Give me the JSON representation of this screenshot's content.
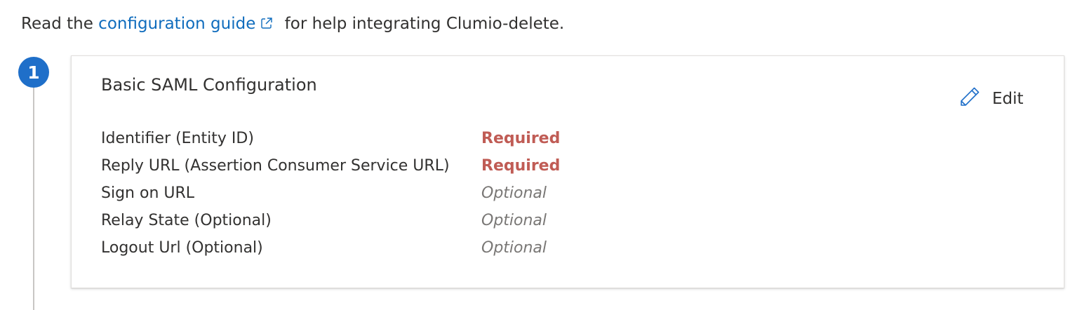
{
  "intro": {
    "prefix": "Read the ",
    "link_text": "configuration guide",
    "suffix": " for help integrating Clumio-delete."
  },
  "step": {
    "number": "1"
  },
  "card": {
    "title": "Basic SAML Configuration",
    "edit_label": "Edit",
    "rows": [
      {
        "label": "Identifier (Entity ID)",
        "status": "Required"
      },
      {
        "label": "Reply URL (Assertion Consumer Service URL)",
        "status": "Required"
      },
      {
        "label": "Sign on URL",
        "status": "Optional"
      },
      {
        "label": "Relay State (Optional)",
        "status": "Optional"
      },
      {
        "label": "Logout Url (Optional)",
        "status": "Optional"
      }
    ]
  },
  "colors": {
    "link": "#0f6cbd",
    "step_badge": "#1f6fc9",
    "required": "#c05c55",
    "optional": "#797775"
  },
  "icons": {
    "external_link": "external-link-icon",
    "edit": "pencil-icon"
  }
}
